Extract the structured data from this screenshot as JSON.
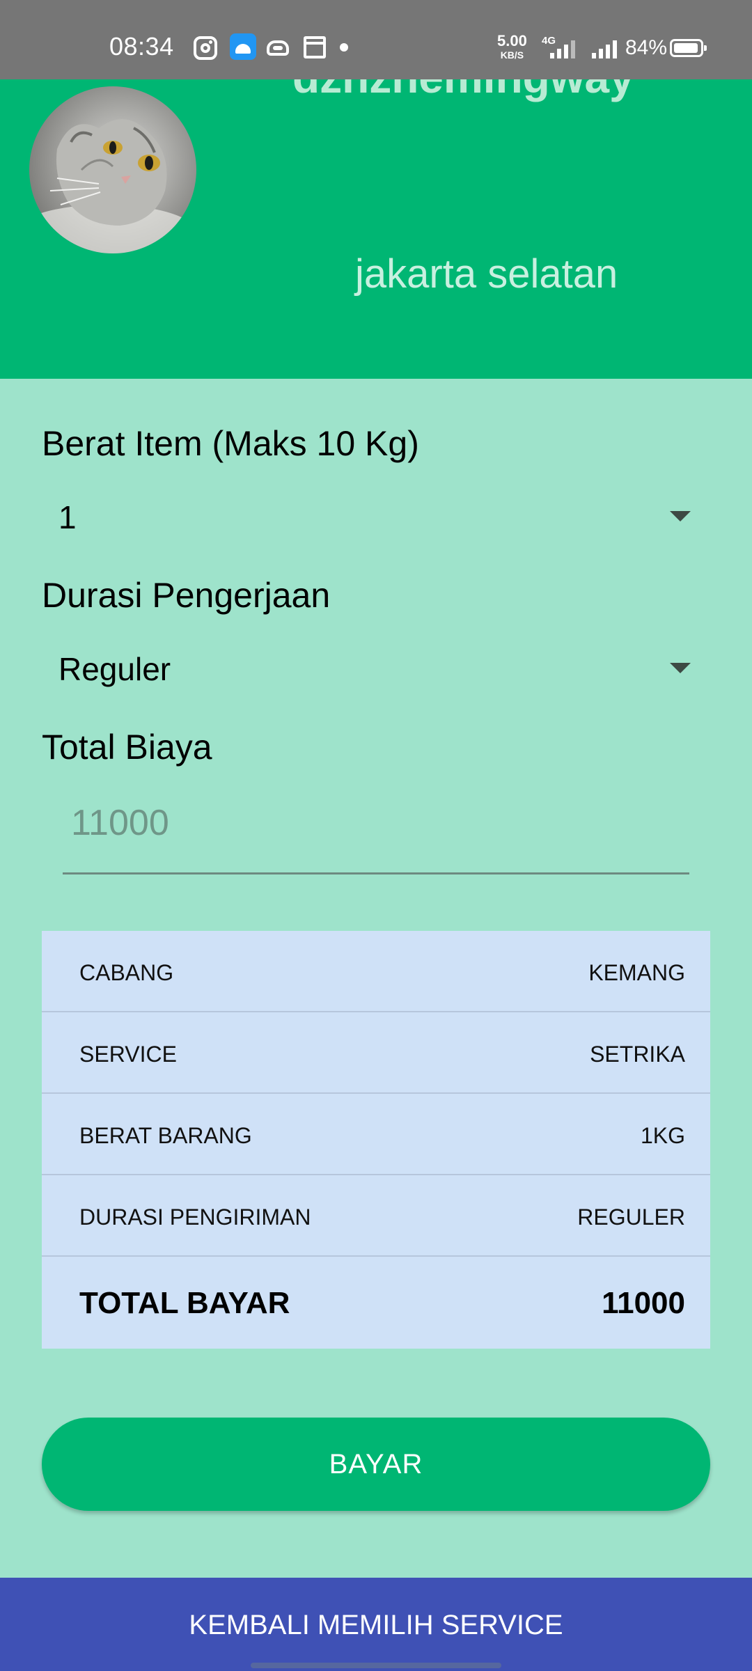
{
  "status_bar": {
    "time": "08:34",
    "net_speed_value": "5.00",
    "net_speed_unit": "KB/S",
    "network_type": "4G",
    "battery_percent": "84%",
    "icons": [
      "instagram-icon",
      "android-debug-icon",
      "bot-icon",
      "calendar-icon",
      "dot-icon",
      "signal-icon",
      "battery-icon"
    ]
  },
  "header": {
    "username": "dzhzhemingway",
    "location": "jakarta selatan",
    "background_color": "#00B673"
  },
  "form": {
    "weight_label": "Berat Item (Maks 10 Kg)",
    "weight_value": "1",
    "duration_label": "Durasi Pengerjaan",
    "duration_value": "Reguler",
    "total_label": "Total Biaya",
    "total_value": "11000"
  },
  "summary": {
    "rows": [
      {
        "key": "CABANG",
        "value": "KEMANG"
      },
      {
        "key": "SERVICE",
        "value": "SETRIKA"
      },
      {
        "key": "BERAT BARANG",
        "value": "1KG"
      },
      {
        "key": "DURASI PENGIRIMAN",
        "value": "REGULER"
      }
    ],
    "total_key": "TOTAL BAYAR",
    "total_value": "11000",
    "background_color": "#CFE1F7"
  },
  "actions": {
    "pay_label": "BAYAR",
    "back_label": "KEMBALI MEMILIH SERVICE",
    "pay_color": "#00B673",
    "back_color": "#3F51B5"
  }
}
